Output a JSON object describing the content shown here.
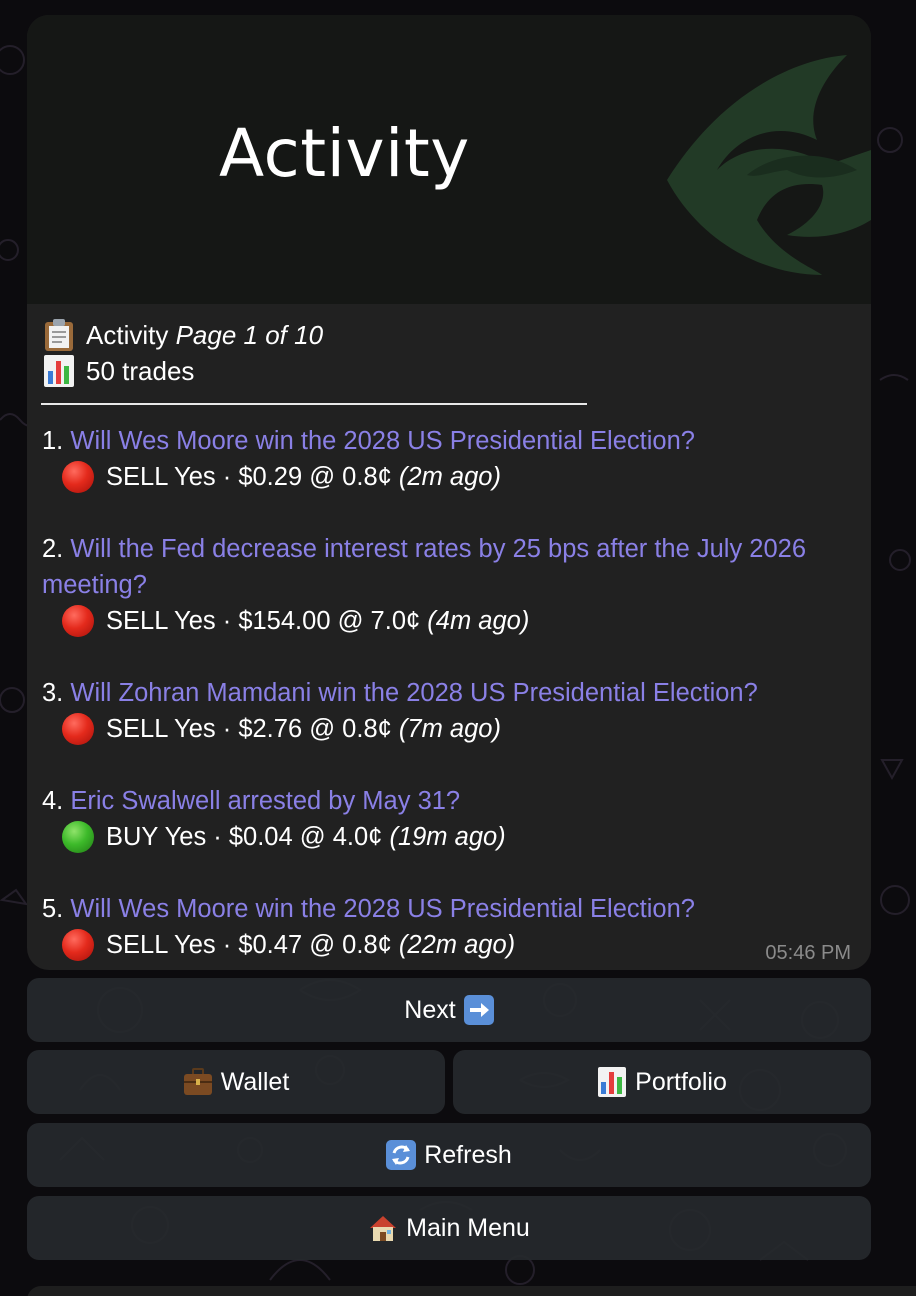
{
  "banner": {
    "title": "Activity"
  },
  "header": {
    "title": "Activity",
    "page_label": "Page 1 of 10",
    "trade_count": "50 trades",
    "clipboard_icon": "clipboard-icon",
    "chart_icon": "bar-chart-icon"
  },
  "trades": [
    {
      "num": "1.",
      "question": "Will Wes Moore win the 2028 US Presidential Election?",
      "status": "red",
      "detail": "SELL Yes · $0.29 @ 0.8¢",
      "ago": "(2m ago)"
    },
    {
      "num": "2.",
      "question": "Will the Fed decrease interest rates by 25 bps after the July 2026 meeting?",
      "status": "red",
      "detail": "SELL Yes · $154.00 @ 7.0¢",
      "ago": "(4m ago)"
    },
    {
      "num": "3.",
      "question": "Will Zohran Mamdani win the 2028 US Presidential Election?",
      "status": "red",
      "detail": "SELL Yes · $2.76 @ 0.8¢",
      "ago": "(7m ago)"
    },
    {
      "num": "4.",
      "question": "Eric Swalwell arrested by May 31?",
      "status": "green",
      "detail": "BUY Yes · $0.04 @ 4.0¢",
      "ago": "(19m ago)"
    },
    {
      "num": "5.",
      "question": "Will Wes Moore win the 2028 US Presidential Election?",
      "status": "red",
      "detail": "SELL Yes · $0.47 @ 0.8¢",
      "ago": "(22m ago)"
    }
  ],
  "timestamp": "05:46 PM",
  "keyboard": {
    "next": "Next",
    "wallet": "Wallet",
    "portfolio": "Portfolio",
    "refresh": "Refresh",
    "main_menu": "Main Menu"
  },
  "colors": {
    "link": "#8a80e6",
    "bubble": "#212121",
    "button": "#26292d",
    "logo": "#2a4a2e"
  }
}
